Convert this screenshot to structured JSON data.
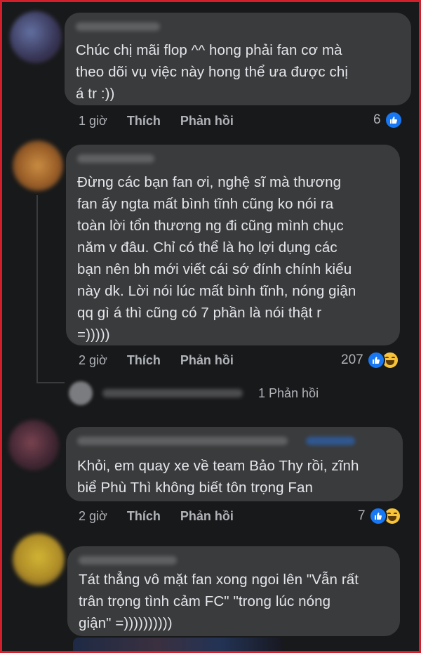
{
  "colors": {
    "background": "#18191a",
    "bubble": "#3a3b3c",
    "text": "#e4e6eb",
    "muted": "#b0b3b8",
    "like_blue": "#1877f2",
    "haha_yellow": "#f7c33a",
    "frame": "#d21f2b"
  },
  "comments": [
    {
      "text": "Chúc chị mãi flop ^^ hong phải fan cơ mà\ntheo dõi vụ việc này hong thể ưa được chị\ná tr :))",
      "time": "1 giờ",
      "like_label": "Thích",
      "reply_label": "Phản hồi",
      "reaction_count": "6",
      "reactions": [
        "like-icon"
      ]
    },
    {
      "text": "Đừng các bạn fan ơi, nghệ sĩ mà thương\nfan ấy ngta mất bình tĩnh cũng ko nói ra\ntoàn lời tổn thương ng đi cũng mình chục\nnăm v đâu. Chỉ có thể là họ lợi dụng các\nbạn nên bh mới viết cái sớ đính chính kiểu\nnày dk. Lời nói lúc mất bình tĩnh, nóng giận\nqq gì á thì cũng có 7 phần là nói thật r\n=)))))",
      "time": "2 giờ",
      "like_label": "Thích",
      "reply_label": "Phản hồi",
      "reaction_count": "207",
      "reactions": [
        "like-icon",
        "haha-icon"
      ],
      "replies_label": "1 Phản hồi"
    },
    {
      "text": "Khỏi, em quay xe về team Bảo Thy rồi, zĩnh\nbiể Phù Thì không biết tôn trọng Fan",
      "time": "2 giờ",
      "like_label": "Thích",
      "reply_label": "Phản hồi",
      "reaction_count": "7",
      "reactions": [
        "like-icon",
        "haha-icon"
      ]
    },
    {
      "text": "Tát thẳng vô mặt fan xong ngoi lên \"Vẫn rất\ntrân trọng tình cảm FC\" \"trong lúc nóng\ngiận\" =))))))))))"
    }
  ]
}
